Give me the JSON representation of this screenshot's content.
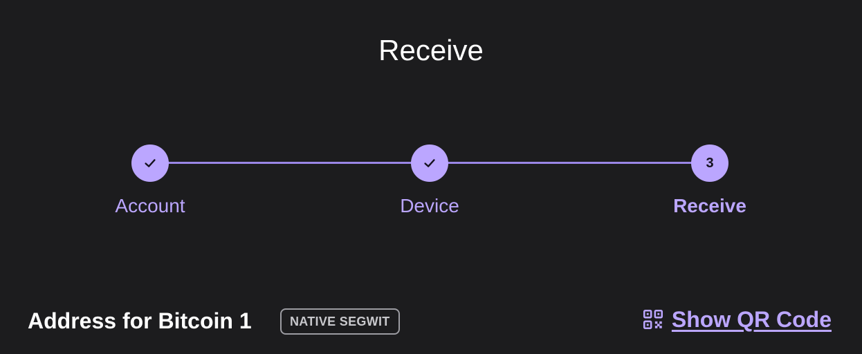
{
  "title": "Receive",
  "stepper": {
    "steps": [
      {
        "label": "Account",
        "state": "completed",
        "indicator": "check-icon"
      },
      {
        "label": "Device",
        "state": "completed",
        "indicator": "check-icon"
      },
      {
        "label": "Receive",
        "state": "active",
        "number": "3"
      }
    ]
  },
  "address": {
    "label": "Address for Bitcoin 1",
    "badge": "NATIVE SEGWIT"
  },
  "qr": {
    "label": "Show QR Code",
    "icon": "qr-code-icon"
  },
  "colors": {
    "background": "#1c1c1e",
    "accent": "#bba6ff",
    "line": "#9a86e6",
    "text": "#ffffff",
    "badge_border": "#9c9ca2"
  }
}
